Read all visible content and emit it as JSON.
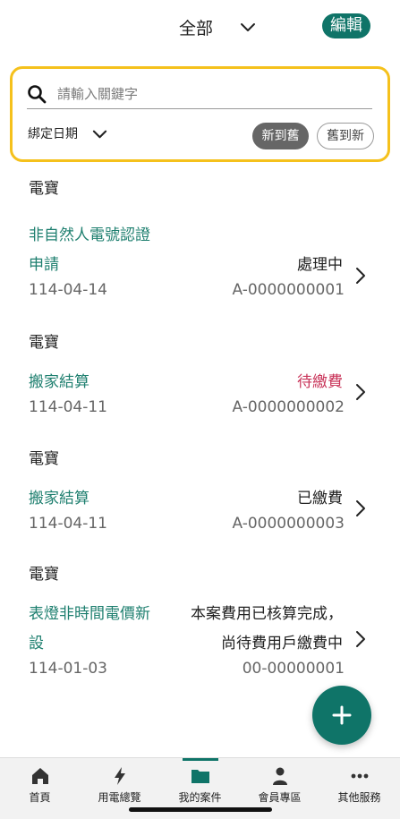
{
  "header": {
    "filter_label": "全部",
    "edit_label": "編輯"
  },
  "search": {
    "placeholder": "請輸入關鍵字",
    "date_filter_label": "綁定日期",
    "sort_new_to_old": "新到舊",
    "sort_old_to_new": "舊到新"
  },
  "cases": [
    {
      "company": "電寶",
      "title_lines": [
        "非自然人電號認證",
        "申請"
      ],
      "status_lines": [
        "處理中"
      ],
      "date": "114-04-14",
      "case_no": "A-0000000001"
    },
    {
      "company": "電寶",
      "title_lines": [
        "搬家結算"
      ],
      "status_lines": [
        "待繳費"
      ],
      "date": "114-04-11",
      "case_no": "A-0000000002"
    },
    {
      "company": "電寶",
      "title_lines": [
        "搬家結算"
      ],
      "status_lines": [
        "已繳費"
      ],
      "date": "114-04-11",
      "case_no": "A-0000000003"
    },
    {
      "company": "電寶",
      "title_lines": [
        "表燈非時間電價新",
        "設"
      ],
      "status_lines": [
        "本案費用已核算完成，",
        "尚待費用戶繳費中"
      ],
      "date": "114-01-03",
      "case_no": "00-00000001"
    }
  ],
  "colors": {
    "accent": "#0f7468",
    "highlight_border": "#f5c11c",
    "status_pending_payment": "#c9365b"
  },
  "bottom_nav": [
    {
      "label": "首頁",
      "icon": "home-icon"
    },
    {
      "label": "用電總覽",
      "icon": "lightning-icon"
    },
    {
      "label": "我的案件",
      "icon": "folder-icon"
    },
    {
      "label": "會員專區",
      "icon": "person-icon"
    },
    {
      "label": "其他服務",
      "icon": "more-icon"
    }
  ],
  "active_nav": "我的案件"
}
